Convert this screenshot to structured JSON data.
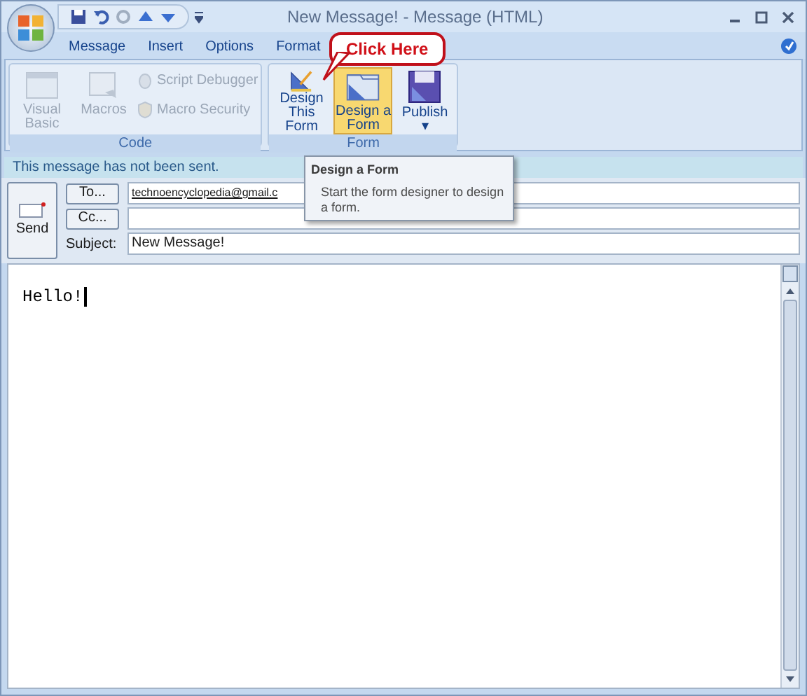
{
  "window": {
    "title": "New Message! - Message (HTML)"
  },
  "tabs": [
    {
      "label": "Message",
      "selected": false
    },
    {
      "label": "Insert",
      "selected": false
    },
    {
      "label": "Options",
      "selected": false
    },
    {
      "label": "Format",
      "selected": false
    }
  ],
  "ribbon": {
    "groups": [
      {
        "label": "Code",
        "items": [
          {
            "kind": "large",
            "label": "Visual Basic",
            "disabled": true,
            "selected": false
          },
          {
            "kind": "large",
            "label": "Macros",
            "disabled": true,
            "selected": false
          },
          {
            "kind": "small",
            "label": "Script Debugger",
            "disabled": true,
            "selected": false
          },
          {
            "kind": "small",
            "label": "Macro Security",
            "disabled": true,
            "selected": false
          }
        ]
      },
      {
        "label": "Form",
        "items": [
          {
            "kind": "large",
            "label": "Design This Form",
            "disabled": false,
            "selected": false
          },
          {
            "kind": "large",
            "label": "Design a Form",
            "disabled": false,
            "selected": true
          },
          {
            "kind": "large",
            "label": "Publish",
            "disabled": false,
            "selected": false,
            "caret": "▾"
          }
        ]
      }
    ]
  },
  "callout": {
    "text": "Click Here"
  },
  "infobar": "This message has not been sent.",
  "tooltip": {
    "title": "Design a Form",
    "text": "Start the form designer to design a form."
  },
  "send_button": "Send",
  "fields": [
    {
      "button": "To...",
      "value": "technoencyclopedia@gmail.c"
    },
    {
      "button": "Cc..."
    },
    {
      "label": "Subject:",
      "value": "New Message!"
    }
  ],
  "body": "Hello!"
}
